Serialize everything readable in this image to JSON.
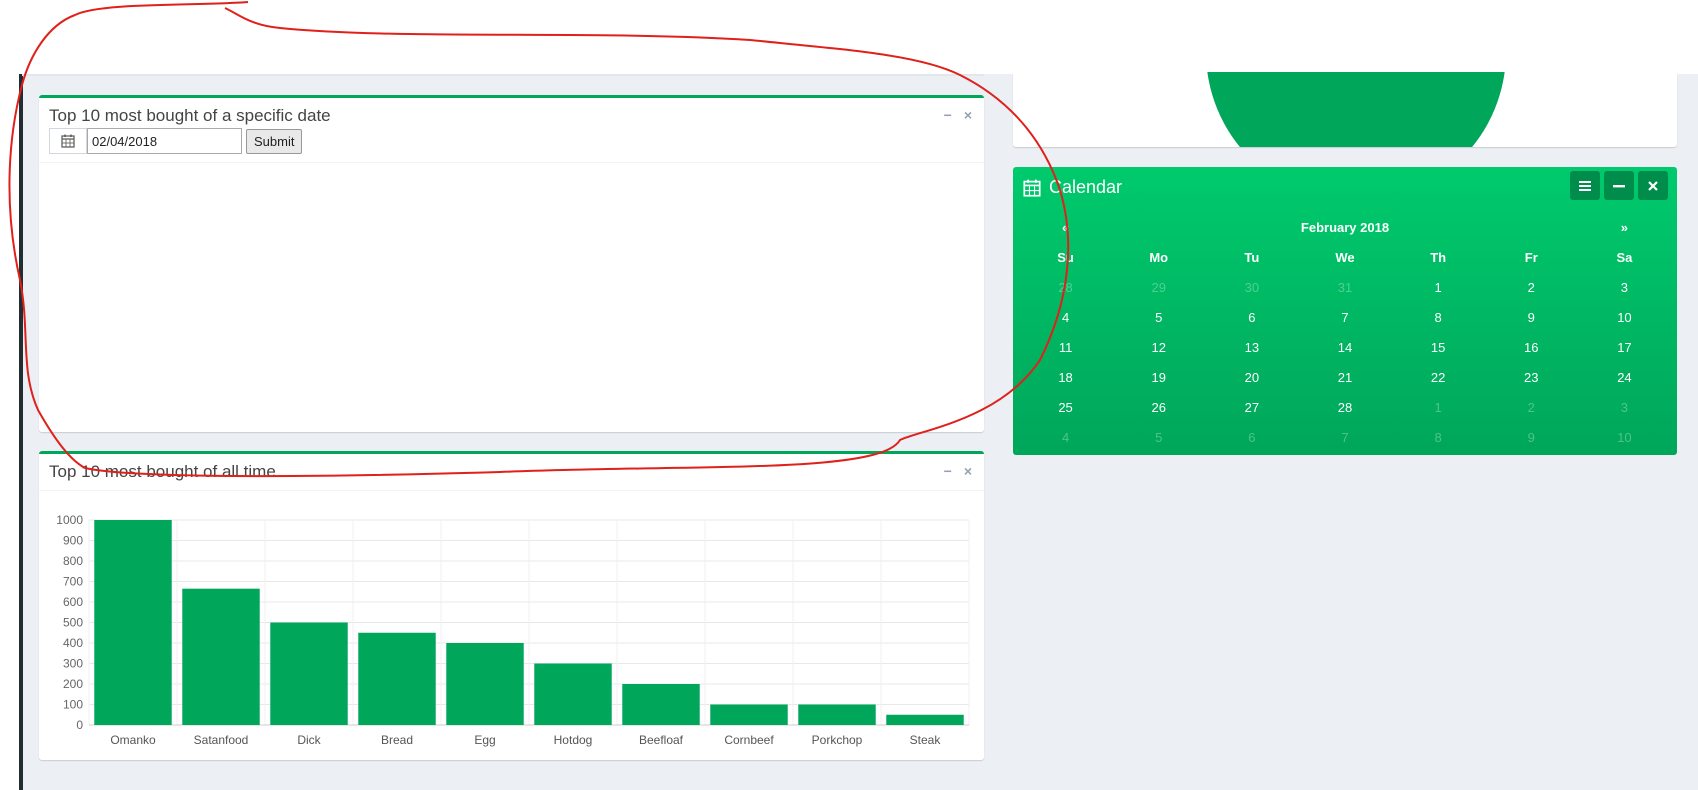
{
  "specific_box": {
    "title": "Top 10 most bought of a specific date",
    "date_value": "02/04/2018",
    "submit_label": "Submit",
    "minimize_glyph": "−",
    "close_glyph": "×"
  },
  "alltime_box": {
    "title": "Top 10 most bought of all time",
    "minimize_glyph": "−",
    "close_glyph": "×"
  },
  "chart_data": {
    "type": "bar",
    "categories": [
      "Omanko",
      "Satanfood",
      "Dick",
      "Bread",
      "Egg",
      "Hotdog",
      "Beefloaf",
      "Cornbeef",
      "Porkchop",
      "Steak"
    ],
    "values": [
      1000,
      665,
      500,
      450,
      400,
      300,
      200,
      100,
      100,
      50
    ],
    "ylim": [
      0,
      1000
    ],
    "yticks": [
      "0",
      "100",
      "200",
      "300",
      "400",
      "500",
      "600",
      "700",
      "800",
      "900",
      "1000"
    ],
    "grid": true,
    "color": "#00a65a"
  },
  "calendar": {
    "title": "Calendar",
    "month_label": "February 2018",
    "prev_label": "«",
    "next_label": "»",
    "weekdays": [
      "Su",
      "Mo",
      "Tu",
      "We",
      "Th",
      "Fr",
      "Sa"
    ],
    "weeks": [
      [
        {
          "d": "28",
          "o": true
        },
        {
          "d": "29",
          "o": true
        },
        {
          "d": "30",
          "o": true
        },
        {
          "d": "31",
          "o": true
        },
        {
          "d": "1"
        },
        {
          "d": "2"
        },
        {
          "d": "3"
        }
      ],
      [
        {
          "d": "4"
        },
        {
          "d": "5"
        },
        {
          "d": "6"
        },
        {
          "d": "7"
        },
        {
          "d": "8"
        },
        {
          "d": "9"
        },
        {
          "d": "10"
        }
      ],
      [
        {
          "d": "11"
        },
        {
          "d": "12"
        },
        {
          "d": "13"
        },
        {
          "d": "14"
        },
        {
          "d": "15"
        },
        {
          "d": "16"
        },
        {
          "d": "17"
        }
      ],
      [
        {
          "d": "18"
        },
        {
          "d": "19"
        },
        {
          "d": "20"
        },
        {
          "d": "21"
        },
        {
          "d": "22"
        },
        {
          "d": "23"
        },
        {
          "d": "24"
        }
      ],
      [
        {
          "d": "25"
        },
        {
          "d": "26"
        },
        {
          "d": "27"
        },
        {
          "d": "28"
        },
        {
          "d": "1",
          "o": true
        },
        {
          "d": "2",
          "o": true
        },
        {
          "d": "3",
          "o": true
        }
      ],
      [
        {
          "d": "4",
          "o": true
        },
        {
          "d": "5",
          "o": true
        },
        {
          "d": "6",
          "o": true
        },
        {
          "d": "7",
          "o": true
        },
        {
          "d": "8",
          "o": true
        },
        {
          "d": "9",
          "o": true
        },
        {
          "d": "10",
          "o": true
        }
      ]
    ],
    "color_top": "#00ca6d",
    "color_bottom": "#00a65a"
  },
  "annotation_color": "#e0201a"
}
